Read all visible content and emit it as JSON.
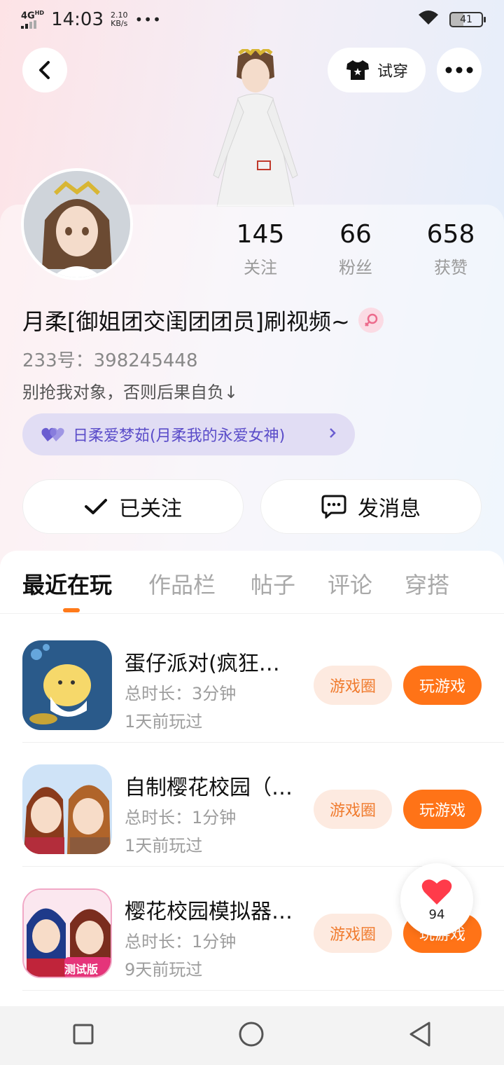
{
  "status_bar": {
    "network": "4G",
    "network_sup": "HD",
    "time": "14:03",
    "speed_value": "2.10",
    "speed_unit": "KB/s",
    "more": "•••",
    "battery": "41"
  },
  "header": {
    "try_on_label": "试穿"
  },
  "profile": {
    "stats": [
      {
        "value": "145",
        "label": "关注"
      },
      {
        "value": "66",
        "label": "粉丝"
      },
      {
        "value": "658",
        "label": "获赞"
      }
    ],
    "username": "月柔[御姐团交闺团团员]刷视频~",
    "uid": "233号：398245448",
    "bio": "别抢我对象，否则后果自负↓",
    "couple_tag": "日柔爱梦茹(月柔我的永爱女神)",
    "follow_label": "已关注",
    "message_label": "发消息"
  },
  "tabs": [
    {
      "label": "最近在玩",
      "active": true
    },
    {
      "label": "作品栏",
      "active": false
    },
    {
      "label": "帖子",
      "active": false
    },
    {
      "label": "评论",
      "active": false
    },
    {
      "label": "穿搭",
      "active": false
    }
  ],
  "games": [
    {
      "name": "蛋仔派对(疯狂…",
      "duration": "总时长：3分钟",
      "last_played": "1天前玩过",
      "circle_label": "游戏圈",
      "play_label": "玩游戏"
    },
    {
      "name": "自制樱花校园（…",
      "duration": "总时长：1分钟",
      "last_played": "1天前玩过",
      "circle_label": "游戏圈",
      "play_label": "玩游戏"
    },
    {
      "name": "樱花校园模拟器…",
      "duration": "总时长：1分钟",
      "last_played": "9天前玩过",
      "circle_label": "游戏圈",
      "play_label": "玩游戏"
    }
  ],
  "game_icon_badge": "测试版",
  "like_fab": {
    "count": "94"
  },
  "colors": {
    "accent": "#ff7317",
    "couple_purple": "#5a4cc9",
    "heart_red": "#ff3b4a"
  }
}
